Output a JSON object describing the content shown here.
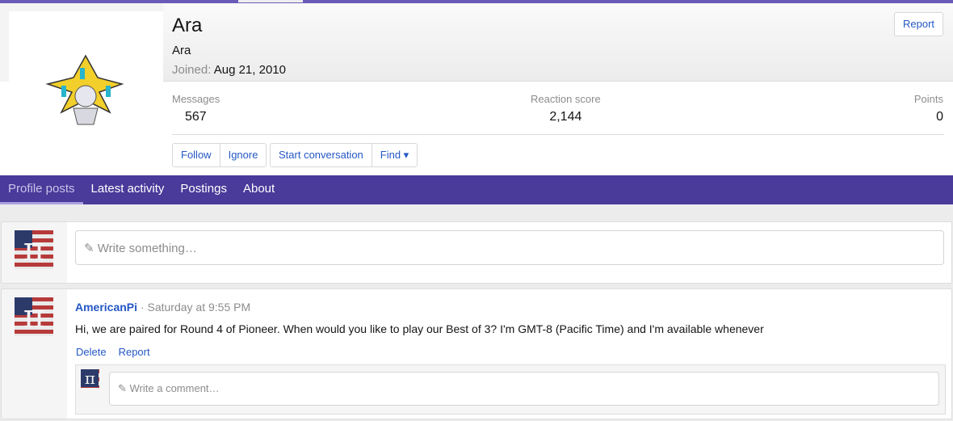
{
  "profile": {
    "name": "Ara",
    "user_title": "Ara",
    "joined_label": "Joined:",
    "joined_date": "Aug 21, 2010",
    "report_label": "Report",
    "stats": [
      {
        "label": "Messages",
        "value": "567"
      },
      {
        "label": "Reaction score",
        "value": "2,144"
      },
      {
        "label": "Points",
        "value": "0"
      }
    ],
    "actions": {
      "follow": "Follow",
      "ignore": "Ignore",
      "start_conversation": "Start conversation",
      "find": "Find ▾"
    }
  },
  "tabs": [
    "Profile posts",
    "Latest activity",
    "Postings",
    "About"
  ],
  "composer": {
    "placeholder": "Write something…",
    "icon": "pencil-icon"
  },
  "post": {
    "author": "AmericanPi",
    "time": "· Saturday at 9:55 PM",
    "body": "Hi, we are paired for Round 4 of Pioneer. When would you like to play our Best of 3? I'm GMT-8 (Pacific Time) and I'm available whenever",
    "delete": "Delete",
    "report": "Report",
    "comment_placeholder": "Write a comment…"
  },
  "colors": {
    "nav": "#4a3a9a",
    "link": "#2457c5"
  }
}
